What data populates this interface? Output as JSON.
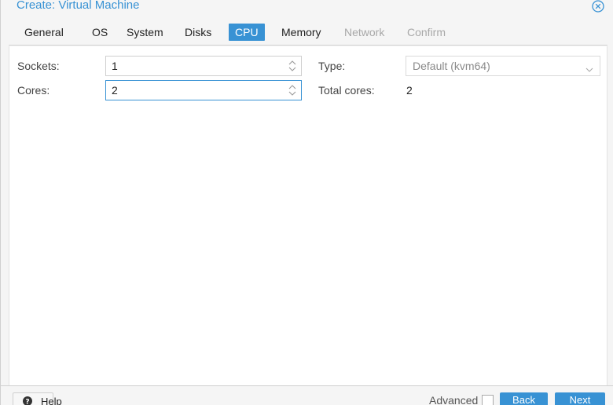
{
  "window": {
    "title": "Create: Virtual Machine"
  },
  "tabs": [
    {
      "label": "General",
      "state": "normal"
    },
    {
      "label": "OS",
      "state": "normal"
    },
    {
      "label": "System",
      "state": "normal"
    },
    {
      "label": "Disks",
      "state": "normal"
    },
    {
      "label": "CPU",
      "state": "active"
    },
    {
      "label": "Memory",
      "state": "normal"
    },
    {
      "label": "Network",
      "state": "disabled"
    },
    {
      "label": "Confirm",
      "state": "disabled"
    }
  ],
  "cpu": {
    "sockets_label": "Sockets:",
    "sockets_value": "1",
    "cores_label": "Cores:",
    "cores_value": "2",
    "type_label": "Type:",
    "type_value": "Default (kvm64)",
    "total_cores_label": "Total cores:",
    "total_cores_value": "2"
  },
  "footer": {
    "help_label": "Help",
    "advanced_label": "Advanced",
    "advanced_checked": false,
    "back_label": "Back",
    "next_label": "Next"
  },
  "icons": {
    "close": "close-circle-icon",
    "spinner": "spinner-arrows-icon",
    "dropdown": "chevron-down-icon",
    "help": "question-circle-icon"
  },
  "colors": {
    "accent": "#3892d4",
    "disabled_text": "#a8a8a8"
  }
}
